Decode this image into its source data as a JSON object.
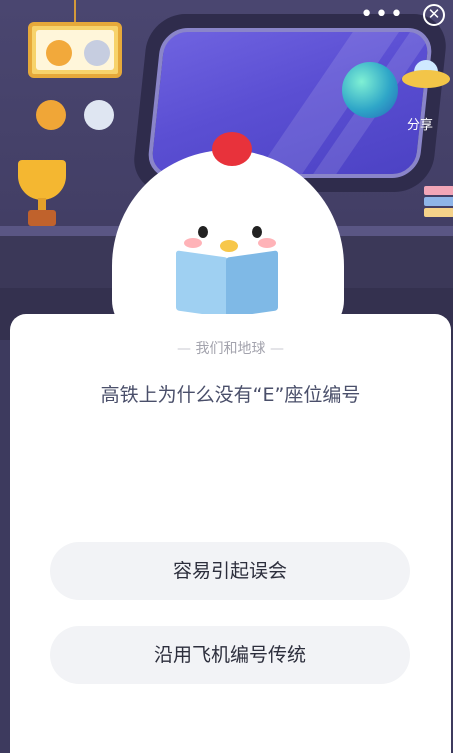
{
  "top_bar": {
    "more_icon": "•••",
    "close_icon": "✕"
  },
  "share": {
    "label": "分享"
  },
  "card": {
    "subtitle": "我们和地球",
    "subtitle_dash": "—",
    "question": "高铁上为什么没有“E”座位编号",
    "options": [
      {
        "label": "容易引起误会"
      },
      {
        "label": "沿用飞机编号传统"
      }
    ]
  },
  "colors": {
    "background": "#3d3a5e",
    "window_sky": "#5b4fd3",
    "option_bg": "#f2f3f6",
    "question_text": "#4a4f6a"
  }
}
